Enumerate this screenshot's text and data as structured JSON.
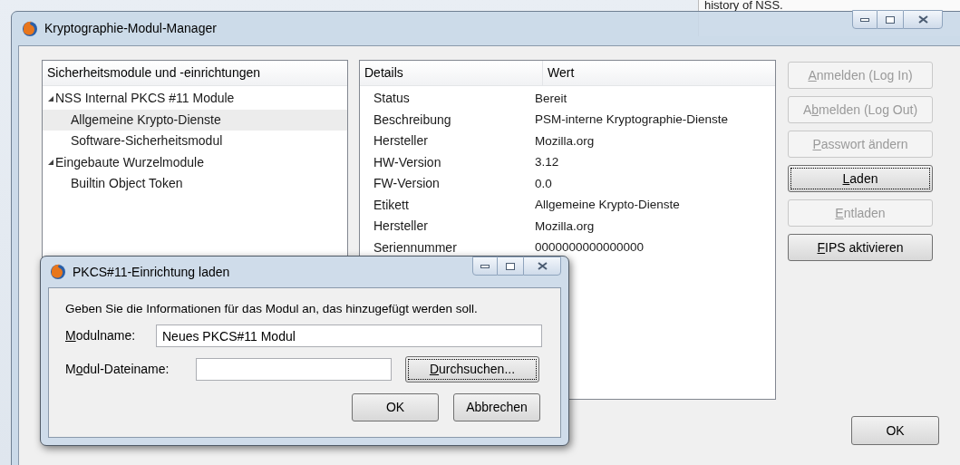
{
  "background": {
    "text": "history of NSS."
  },
  "window": {
    "title": "Kryptographie-Modul-Manager"
  },
  "modules_tree": {
    "header": "Sicherheitsmodule und -einrichtungen",
    "items": [
      {
        "label": "NSS Internal PKCS #11 Module",
        "expanded": true,
        "selected": false,
        "children": [
          {
            "label": "Allgemeine Krypto-Dienste",
            "selected": true
          },
          {
            "label": "Software-Sicherheitsmodul",
            "selected": false
          }
        ]
      },
      {
        "label": "Eingebaute Wurzelmodule",
        "expanded": true,
        "selected": false,
        "children": [
          {
            "label": "Builtin Object Token",
            "selected": false
          }
        ]
      }
    ]
  },
  "details_table": {
    "columns": [
      "Details",
      "Wert"
    ],
    "rows": [
      {
        "name": "Status",
        "value": "Bereit"
      },
      {
        "name": "Beschreibung",
        "value": "PSM-interne Kryptographie-Dienste"
      },
      {
        "name": "Hersteller",
        "value": "Mozilla.org"
      },
      {
        "name": "HW-Version",
        "value": "3.12"
      },
      {
        "name": "FW-Version",
        "value": "0.0"
      },
      {
        "name": "Etikett",
        "value": "Allgemeine Krypto-Dienste"
      },
      {
        "name": "Hersteller",
        "value": "Mozilla.org"
      },
      {
        "name": "Seriennummer",
        "value": "0000000000000000"
      }
    ]
  },
  "buttons": [
    {
      "label": {
        "key": "A",
        "after": "nmelden (Log In)"
      },
      "disabled": true,
      "focused": false
    },
    {
      "label": {
        "before": "A",
        "key": "b",
        "after": "melden (Log Out)"
      },
      "disabled": true,
      "focused": false
    },
    {
      "label": {
        "key": "P",
        "after": "asswort ändern"
      },
      "disabled": true,
      "focused": false
    },
    {
      "label": {
        "key": "L",
        "after": "aden"
      },
      "disabled": false,
      "focused": true
    },
    {
      "label": {
        "key": "E",
        "after": "ntladen"
      },
      "disabled": true,
      "focused": false
    },
    {
      "label": {
        "key": "F",
        "after": "IPS aktivieren"
      },
      "disabled": false,
      "focused": false
    }
  ],
  "ok_button": {
    "label": "OK"
  },
  "dialog": {
    "title": "PKCS#11-Einrichtung laden",
    "instruction": "Geben Sie die Informationen für das Modul an, das hinzugefügt werden soll.",
    "module_name": {
      "label": {
        "key": "M",
        "after": "odulname:"
      },
      "value": "Neues PKCS#11 Modul"
    },
    "module_file": {
      "label": {
        "before": "M",
        "key": "o",
        "after": "dul-Dateiname:"
      }
    },
    "browse_button": {
      "label": {
        "key": "D",
        "after": "urchsuchen..."
      },
      "focused": true
    },
    "buttons": [
      {
        "label": "OK"
      },
      {
        "label": "Abbrechen"
      }
    ]
  }
}
